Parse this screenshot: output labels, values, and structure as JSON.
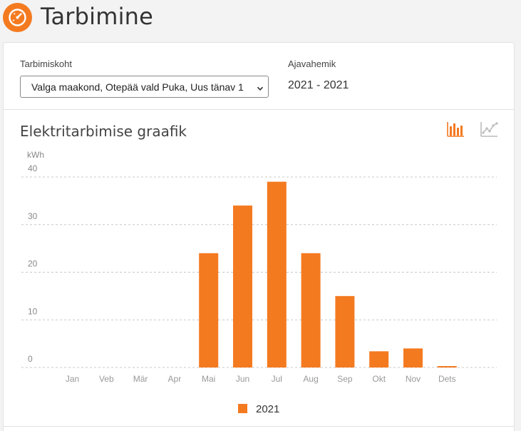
{
  "page": {
    "title": "Tarbimine"
  },
  "filters": {
    "place_label": "Tarbimiskoht",
    "place_value": "Valga maakond, Otepää vald Puka, Uus tänav 1",
    "period_label": "Ajavahemik",
    "period_value": "2021 - 2021"
  },
  "chart": {
    "title": "Elektritarbimise graafik",
    "icons": [
      "bar-chart-icon",
      "line-chart-icon"
    ],
    "accent": "#f47a20"
  },
  "chart_data": {
    "type": "bar",
    "title": "",
    "ylabel": "kWh",
    "xlabel": "",
    "categories": [
      "Jan",
      "Veb",
      "Mär",
      "Apr",
      "Mai",
      "Jun",
      "Jul",
      "Aug",
      "Sep",
      "Okt",
      "Nov",
      "Dets"
    ],
    "series": [
      {
        "name": "2021",
        "values": [
          0,
          0,
          0,
          0,
          24,
          34,
          39,
          24,
          15,
          3.4,
          4,
          0.3
        ],
        "color": "#f47a20"
      }
    ],
    "yticks": [
      "0",
      "10",
      "20",
      "30",
      "40"
    ],
    "ylim": [
      0,
      40
    ],
    "grid": true,
    "legend": "bottom-center"
  }
}
